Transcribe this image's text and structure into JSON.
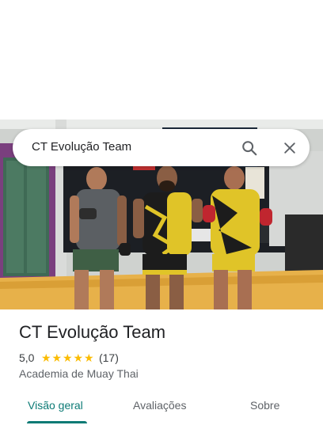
{
  "search": {
    "query": "CT Evolução Team"
  },
  "place": {
    "title": "CT Evolução Team",
    "rating": "5,0",
    "stars": [
      "★",
      "★",
      "★",
      "★",
      "★"
    ],
    "review_count": "(17)",
    "category": "Academia de Muay Thai"
  },
  "tabs": [
    {
      "label": "Visão geral",
      "active": true
    },
    {
      "label": "Avaliações",
      "active": false
    },
    {
      "label": "Sobre",
      "active": false
    }
  ],
  "colors": {
    "accent": "#0b7a75",
    "star": "#fbbc04",
    "text_primary": "#202124",
    "text_secondary": "#5f6368"
  },
  "icons": {
    "search": "search-icon",
    "close": "close-icon"
  }
}
